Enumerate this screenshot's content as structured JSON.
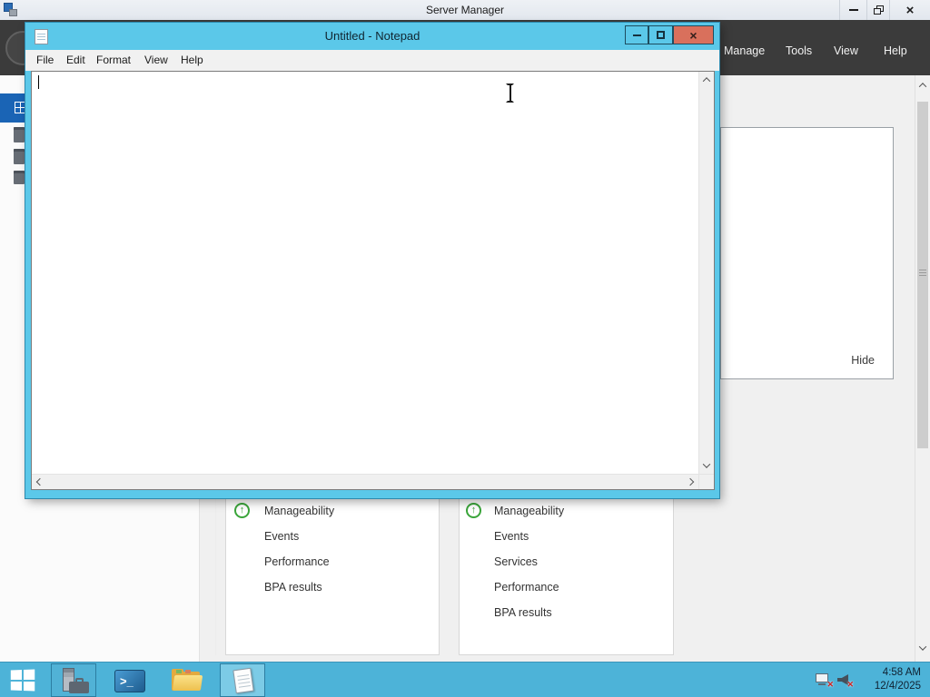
{
  "server_manager": {
    "title": "Server Manager",
    "menu": [
      "Manage",
      "Tools",
      "View",
      "Help"
    ],
    "welcome_tile": {
      "hide_label": "Hide"
    },
    "role_tiles": [
      {
        "rows": [
          "Manageability",
          "Events",
          "Performance",
          "BPA results"
        ]
      },
      {
        "rows": [
          "Manageability",
          "Events",
          "Services",
          "Performance",
          "BPA results"
        ]
      }
    ],
    "status_icon": "up-arrow-circle"
  },
  "notepad": {
    "title": "Untitled - Notepad",
    "menu": [
      "File",
      "Edit",
      "Format",
      "View",
      "Help"
    ],
    "text": ""
  },
  "taskbar": {
    "tray": {
      "time": "4:58 AM",
      "date": "12/4/2025"
    }
  },
  "icons": {
    "up_arrow": "↑"
  },
  "colors": {
    "notepad_chrome": "#5bc8e9",
    "notepad_close": "#d9705c",
    "taskbar_blue": "#4db3d8",
    "navbar_dark": "#3b3b3b",
    "selection_blue": "#1a64b5",
    "status_green": "#3aa53a"
  }
}
